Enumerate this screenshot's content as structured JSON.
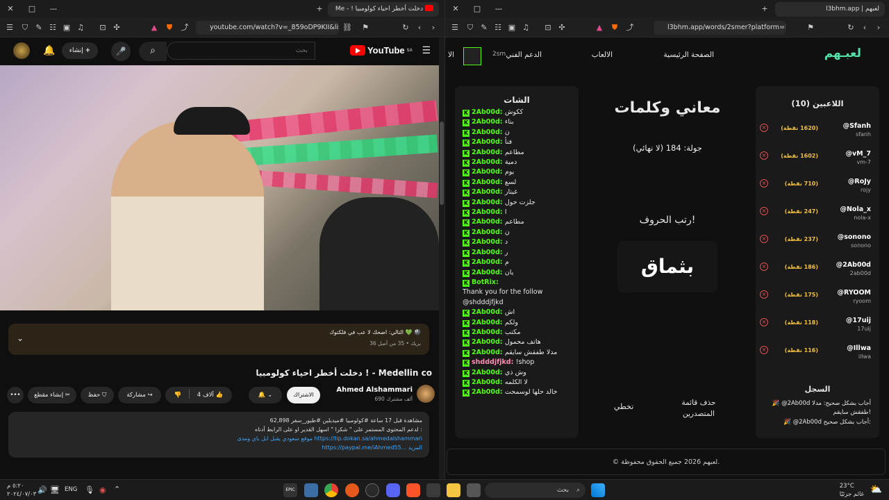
{
  "left": {
    "tab_title": "دخلت أخطر احياء كولومبيا ! - ‪Me",
    "url": "youtube.com/watch?v=_859oDP9KII&list=...",
    "create_label": "إنشاء",
    "search_placeholder": "بحث",
    "logo_text": "YouTube",
    "logo_region": "SA",
    "comment_line1": "التالي: اضحك لا عب في فلكتوك 💚 🎱",
    "comment_line2": "بريك • 35 من أصل 36",
    "video_title": "دخلت أخطر احياء كولومبيا ! - Medellin co",
    "channel_name": "Ahmed Alshammari",
    "subscribers": "690 ألف مشترك",
    "subscribe_label": "الاشتراك",
    "likes": "4 آلاف",
    "share_label": "مشاركة",
    "save_label": "حفظ",
    "clip_label": "إنشاء مقطع",
    "desc_line1": "62,898 مشاهدة قبل 17 ساعة #كولومبيا #ميديلين #طيور_سفر",
    "desc_line2": "لدعم المحتوى المستمر على \" شكرا \" اسهل القدير او على الرابط أدناه :",
    "desc_line3": "موقع سعودي يقبل ابل باي ومدى https://tip.dokan.sa/ahmedalshammari",
    "desc_line4": "https://paypal.me/iAhmed55... المزيد"
  },
  "right": {
    "tab_title": "لعبهم | l3bhm.app",
    "url": "l3bhm.app/words/2smer?platform=kick",
    "brand": "لعبـهم",
    "nav": [
      "الصفحة الرئيسية",
      "الالعاب",
      "الدعم الفني",
      "الا"
    ],
    "user_short": "2sm",
    "players_title": "اللاعبين (10)",
    "players": [
      {
        "name": "@Sfanh",
        "handle": "sfanh",
        "points": "(1620 نقطة)"
      },
      {
        "name": "@vM_7",
        "handle": "vm-7",
        "points": "(1602 نقطة)"
      },
      {
        "name": "@RoJy",
        "handle": "rojy",
        "points": "(710 نقطة)"
      },
      {
        "name": "@Nola_x",
        "handle": "nola-x",
        "points": "(247 نقطة)"
      },
      {
        "name": "@sonono",
        "handle": "sonono",
        "points": "(237 نقطة)"
      },
      {
        "name": "@2Ab00d",
        "handle": "2ab00d",
        "points": "(186 نقطة)"
      },
      {
        "name": "@RYOOM",
        "handle": "ryoom",
        "points": "(175 نقطة)"
      },
      {
        "name": "@17uij",
        "handle": "17uij",
        "points": "(118 نقطة)"
      },
      {
        "name": "@Illwa",
        "handle": "illwa",
        "points": "(116 نقطة)"
      }
    ],
    "log_title": "السجل",
    "log": [
      "🎉 @2Ab00d أجاب بشكل صحيح: مدلا طفقش سايقم!",
      "🎉 @2Ab00d أجاب بشكل صحيح:"
    ],
    "game_title": "معاني وكلمات",
    "round": "جولة: 184 (لا نهائي)",
    "prompt": "رتب الحروف!",
    "scrambled": "بثماق",
    "btn_clear": "حذف قائمة المتصدرين",
    "btn_skip": "تخطي",
    "chat_title": "الشات",
    "chat": [
      {
        "u": "2Ab00d:",
        "m": "ككوش"
      },
      {
        "u": "2Ab00d:",
        "m": "بناء"
      },
      {
        "u": "2Ab00d:",
        "m": "ن"
      },
      {
        "u": "2Ab00d:",
        "m": "فنأ"
      },
      {
        "u": "2Ab00d:",
        "m": "مطاعم"
      },
      {
        "u": "2Ab00d:",
        "m": "دمية"
      },
      {
        "u": "2Ab00d:",
        "m": "يوم"
      },
      {
        "u": "2Ab00d:",
        "m": "لسع"
      },
      {
        "u": "2Ab00d:",
        "m": "غيتار"
      },
      {
        "u": "2Ab00d:",
        "m": "جلزت حول"
      },
      {
        "u": "2Ab00d:",
        "m": "ا"
      },
      {
        "u": "2Ab00d:",
        "m": "مطاعم"
      },
      {
        "u": "2Ab00d:",
        "m": "ن"
      },
      {
        "u": "2Ab00d:",
        "m": "د"
      },
      {
        "u": "2Ab00d:",
        "m": "ر"
      },
      {
        "u": "2Ab00d:",
        "m": "م"
      },
      {
        "u": "2Ab00d:",
        "m": "يان"
      },
      {
        "u": "BotRix:",
        "m": ""
      },
      {
        "u": "",
        "m": "Thank you for the follow"
      },
      {
        "u": "",
        "m": "@shdddjfjkd"
      },
      {
        "u": "2Ab00d:",
        "m": "اش"
      },
      {
        "u": "2Ab00d:",
        "m": "ولكم"
      },
      {
        "u": "2Ab00d:",
        "m": "مكتب"
      },
      {
        "u": "2Ab00d:",
        "m": "هاتف محمول"
      },
      {
        "u": "2Ab00d:",
        "m": "مدلا طفقش سايقم"
      },
      {
        "u": "shdddjfjkd:",
        "m": "!shop"
      },
      {
        "u": "2Ab00d:",
        "m": "وش ذي"
      },
      {
        "u": "2Ab00d:",
        "m": "لا الكلمه"
      },
      {
        "u": "2Ab00d:",
        "m": "خالد حلها لوسمحت"
      }
    ],
    "footer": "© لعبهم 2026 جميع الحقوق محفوظة."
  },
  "taskbar": {
    "search": "بحث",
    "lang": "ENG",
    "time": "٥:٢٠ م",
    "date": "٢٠٢٤/٠٧/٠٣",
    "weather_temp": "23°C",
    "weather_text": "غائم جزئيًا"
  },
  "colors": {
    "kick_green": "#53fc18",
    "points_gold": "#f0c040",
    "yt_red": "#ff0000"
  }
}
